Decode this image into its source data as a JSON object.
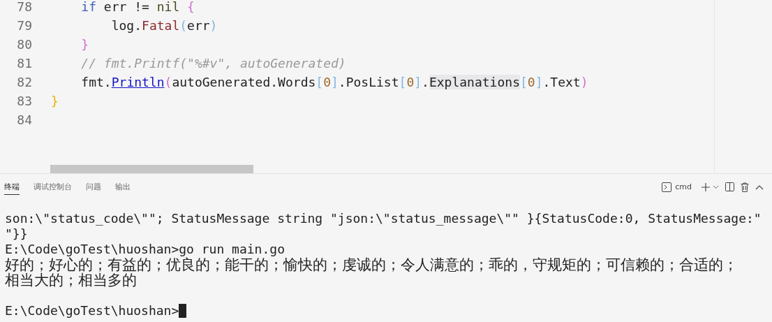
{
  "editor": {
    "lines": [
      {
        "number": "78",
        "tokens": [
          {
            "text": "    if",
            "kind": "keyword"
          },
          {
            "text": " err != ",
            "kind": "text"
          },
          {
            "text": "nil",
            "kind": "constant"
          },
          {
            "text": " {",
            "kind": "bracket2"
          }
        ]
      },
      {
        "number": "79",
        "tokens": [
          {
            "text": "        log.",
            "kind": "text"
          },
          {
            "text": "Fatal",
            "kind": "function"
          },
          {
            "text": "(",
            "kind": "bracket3"
          },
          {
            "text": "err",
            "kind": "text"
          },
          {
            "text": ")",
            "kind": "bracket3"
          }
        ]
      },
      {
        "number": "80",
        "tokens": [
          {
            "text": "    }",
            "kind": "bracket2"
          }
        ]
      },
      {
        "number": "81",
        "tokens": [
          {
            "text": "    // fmt.Printf(\"%#v\", autoGenerated)",
            "kind": "comment"
          }
        ]
      },
      {
        "number": "82",
        "tokens": [
          {
            "text": "    fmt.",
            "kind": "text"
          },
          {
            "text": "Println",
            "kind": "link"
          },
          {
            "text": "(",
            "kind": "bracket2"
          },
          {
            "text": "autoGenerated.Words",
            "kind": "text"
          },
          {
            "text": "[",
            "kind": "bracket3"
          },
          {
            "text": "0",
            "kind": "number"
          },
          {
            "text": "]",
            "kind": "bracket3"
          },
          {
            "text": ".PosList",
            "kind": "text"
          },
          {
            "text": "[",
            "kind": "bracket3"
          },
          {
            "text": "0",
            "kind": "number"
          },
          {
            "text": "]",
            "kind": "bracket3"
          },
          {
            "text": ".",
            "kind": "text"
          },
          {
            "text": "Explanations",
            "kind": "highlight"
          },
          {
            "text": "[",
            "kind": "bracket3"
          },
          {
            "text": "0",
            "kind": "number"
          },
          {
            "text": "]",
            "kind": "bracket3"
          },
          {
            "text": ".Text",
            "kind": "text"
          },
          {
            "text": ")",
            "kind": "bracket2"
          }
        ]
      },
      {
        "number": "83",
        "tokens": [
          {
            "text": "}",
            "kind": "bracket1"
          }
        ]
      },
      {
        "number": "84"
      }
    ]
  },
  "panel": {
    "tabs": [
      {
        "label": "终端",
        "selected": true
      },
      {
        "label": "调试控制台",
        "selected": false
      },
      {
        "label": "问题",
        "selected": false
      },
      {
        "label": "输出",
        "selected": false
      }
    ],
    "shell": "cmd",
    "terminal": [
      {
        "text": "son:\\\"status_code\\\"\"; StatusMessage string \"json:\\\"status_message\\\"\" }{StatusCode:0, StatusMessage:\"",
        "kind": "ascii",
        "cursor": false
      },
      {
        "text": "\"}}",
        "kind": "ascii",
        "cursor": false
      },
      {
        "text": "E:\\Code\\goTest\\huoshan>go run main.go",
        "kind": "ascii",
        "cursor": false
      },
      {
        "text": "好的；好心的；有益的；优良的；能干的；愉快的；虔诚的；令人满意的；乖的，守规矩的；可信赖的；合适的；",
        "kind": "wide",
        "cursor": false
      },
      {
        "text": "相当大的；相当多的",
        "kind": "wide",
        "cursor": false
      },
      {
        "kind": "blank",
        "cursor": false
      },
      {
        "text": "E:\\Code\\goTest\\huoshan>",
        "kind": "ascii",
        "cursor": true
      }
    ]
  }
}
